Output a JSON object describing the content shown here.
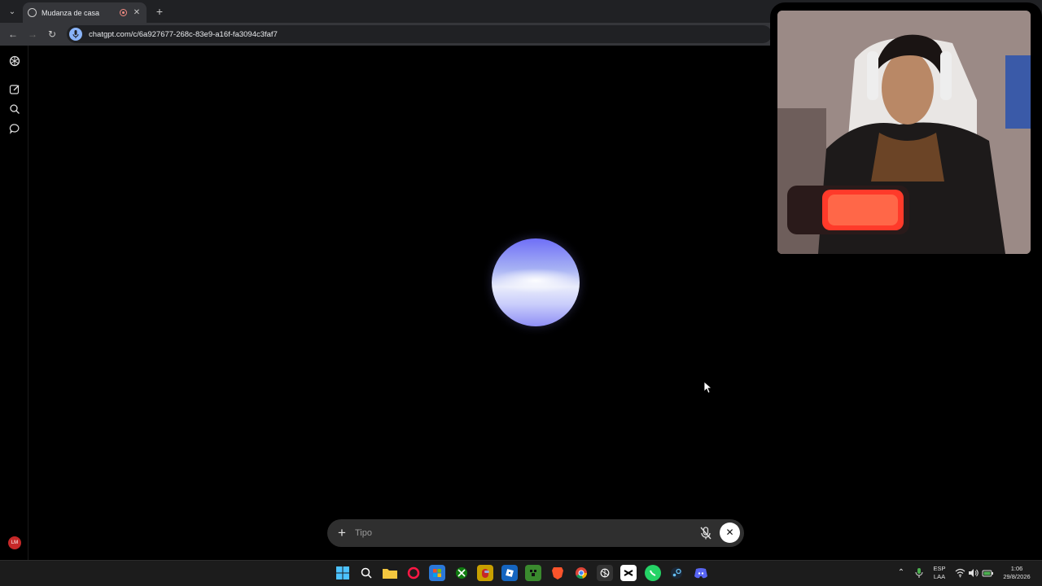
{
  "browser": {
    "tab_title": "Mudanza de casa",
    "url": "chatgpt.com/c/6a927677-268c-83e9-a16f-fa3094c3faf7"
  },
  "sidebar": {
    "avatar_initials": "LM"
  },
  "composer": {
    "placeholder": "Tipo"
  },
  "tray": {
    "lang_top": "ESP",
    "lang_bottom": "LAA",
    "time": "1:06",
    "date": "29/8/2026"
  },
  "taskbar_icons": [
    "windows-start-icon",
    "search-icon",
    "file-explorer-icon",
    "opera-gx-icon",
    "microsoft-store-icon",
    "xbox-icon",
    "among-us-icon",
    "roblox-icon",
    "minecraft-icon",
    "brave-icon",
    "chrome-icon",
    "chatgpt-icon",
    "capcut-icon",
    "whatsapp-icon",
    "steam-icon",
    "discord-icon"
  ],
  "colors": {
    "accent_avatar": "#c62828",
    "orb_blue": "#7f7ff6"
  }
}
